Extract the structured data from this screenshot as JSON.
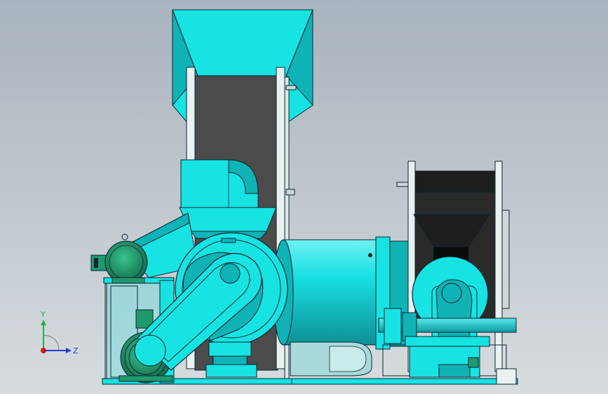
{
  "viewport": {
    "background_top": "#a9b3bd",
    "background_bottom": "#d7dcdf"
  },
  "colors": {
    "machine_cyan": "#17e3e3",
    "machine_cyan_shade": "#0fb3b6",
    "machine_cyan_dark": "#0a7f85",
    "belt_dark": "#4b4b4b",
    "belt_black": "#1e1e1e",
    "motor_green": "#1f9a6d",
    "frame_cyan": "#1fd6d9",
    "outline": "#0b2430",
    "duct_pale": "#a9d9da"
  },
  "triad": {
    "y_label": "Y",
    "z_label": "Z",
    "y_color": "#19b34a",
    "z_color": "#1f3fd6",
    "origin_color": "#d01a1a"
  }
}
